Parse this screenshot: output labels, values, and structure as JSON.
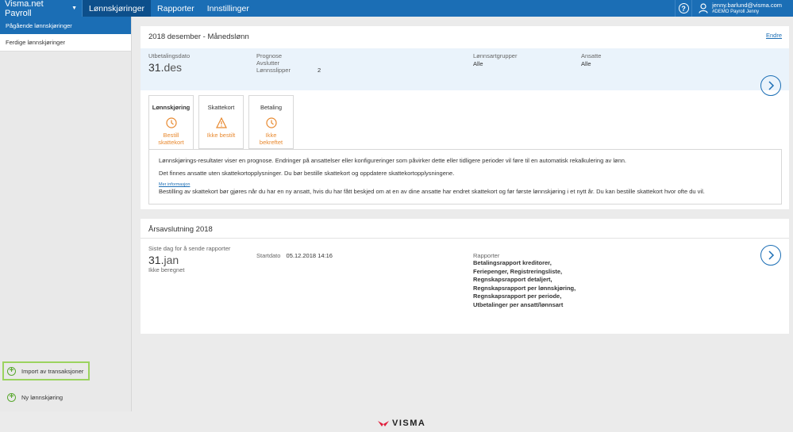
{
  "header": {
    "app_title": "Visma.net Payroll",
    "tabs": [
      {
        "label": "Lønnskjøringer",
        "active": true
      },
      {
        "label": "Rapporter",
        "active": false
      },
      {
        "label": "Innstillinger",
        "active": false
      }
    ],
    "help_label": "?",
    "user_email": "jenny.barlund@visma.com",
    "user_org": "#DEMO Payroll Jenny"
  },
  "sidebar": {
    "items": [
      {
        "label": "Pågående lønnskjøringer",
        "active": true
      },
      {
        "label": "Ferdige lønnskjøringer",
        "active": false
      }
    ],
    "actions": [
      {
        "label": "Import av transaksjoner",
        "highlighted": true
      },
      {
        "label": "Ny lønnskjøring",
        "highlighted": false
      }
    ]
  },
  "payrun": {
    "title": "2018 desember - Månedslønn",
    "edit_label": "Endre",
    "payout_date_label": "Utbetalingsdato",
    "payout_day": "31.",
    "payout_month": "des",
    "status_lines": [
      "Prognose",
      "Avslutter"
    ],
    "payslips_label": "Lønnsslipper",
    "payslips_count": "2",
    "wage_groups_label": "Lønnsartgrupper",
    "wage_groups_value": "Alle",
    "employees_label": "Ansatte",
    "employees_value": "Alle",
    "workflow_tabs": [
      {
        "title": "Lønnskjøring",
        "icon": "clock-icon",
        "status_line1": "Bestill",
        "status_line2": "skattekort",
        "active": true
      },
      {
        "title": "Skattekort",
        "icon": "warning-icon",
        "status_line1": "Ikke bestilt",
        "status_line2": "",
        "active": false
      },
      {
        "title": "Betaling",
        "icon": "clock-icon",
        "status_line1": "Ikke",
        "status_line2": "bekreftet",
        "active": false
      }
    ],
    "info_text_1": "Lønnskjørings-resultater viser en prognose. Endringer på ansattelser eller konfigureringer som påvirker dette eller tidligere perioder vil føre til en automatisk rekalkulering av lønn.",
    "info_text_2": "Det finnes ansatte uten skattekortopplysninger. Du bør bestille skattekort og oppdatere skattekortopplysningene.",
    "more_info_label": "Mer informasjon",
    "info_text_3": "Bestilling av skattekort bør gjøres når du har en ny ansatt, hvis du har fått beskjed om at en av dine ansatte har endret skattekort og før første lønnskjøring i et nytt år. Du kan bestille skattekort hvor ofte du vil."
  },
  "year_end": {
    "title": "Årsavslutning 2018",
    "deadline_label": "Siste dag for å sende rapporter",
    "deadline_day": "31.",
    "deadline_month": "jan",
    "status": "Ikke beregnet",
    "start_label": "Startdato",
    "start_value": "05.12.2018 14:16",
    "reports_label": "Rapporter",
    "reports_text": "Betalingsrapport kreditorer, Feriepenger, Registreringsliste, Regnskapsrapport detaljert, Regnskapsrapport per lønnskjøring, Regnskapsrapport per periode, Utbetalinger per ansatt/lønnsart"
  },
  "footer": {
    "logo_text": "VISMA"
  },
  "colors": {
    "brand_blue": "#1b6eb5",
    "active_tab": "#0d4f8b",
    "warning_orange": "#e8892f",
    "action_green": "#5aa830",
    "highlight_green": "#9bd35f",
    "logo_red": "#e01e3c"
  }
}
